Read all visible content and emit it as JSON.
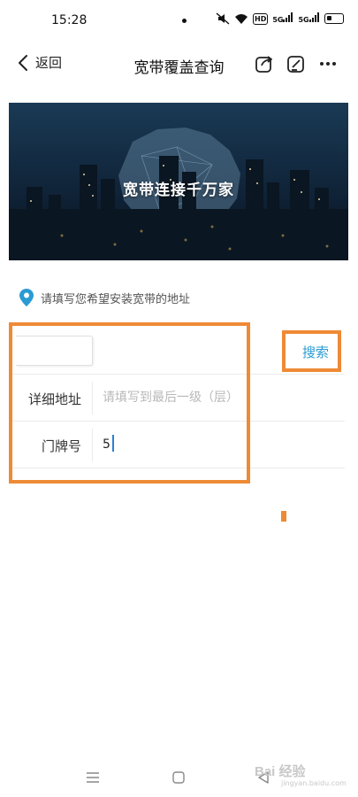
{
  "status_bar": {
    "time": "15:28",
    "icons": [
      "silent-icon",
      "wifi-icon",
      "hd-icon",
      "signal-5g-icon",
      "signal-5g-icon",
      "battery-icon"
    ],
    "hd_label": "HD",
    "net_label_1": "5G",
    "net_label_2": "5G"
  },
  "nav": {
    "back_label": "返回",
    "title": "宽带覆盖查询"
  },
  "banner": {
    "text": "宽带连接千万家"
  },
  "location_hint": "请填写您希望安装宽带的地址",
  "form": {
    "search_label": "搜索",
    "detail_label": "详细地址",
    "detail_placeholder": "请填写到最后一级（层）",
    "detail_value": "",
    "house_label": "门牌号",
    "house_value": "5"
  },
  "watermark": {
    "text": "Bai 经验",
    "sub": "jingyan.baidu.com"
  },
  "colors": {
    "accent": "#2b9bd4",
    "highlight": "#ee8a36"
  }
}
